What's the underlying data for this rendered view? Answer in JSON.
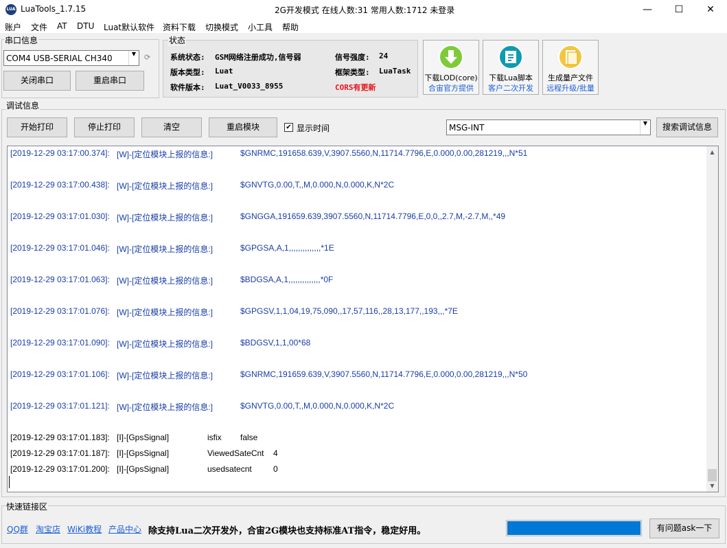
{
  "window": {
    "app_title": "LuaTools_1.7.15",
    "status_title": "2G开发模式 在线人数:31 常用人数:1712 未登录",
    "minimize": "—",
    "maximize": "☐",
    "close": "✕",
    "icon_text": "LUA"
  },
  "menu": [
    "账户",
    "文件",
    "AT",
    "DTU",
    "Luat默认软件",
    "资料下载",
    "切换模式",
    "小工具",
    "帮助"
  ],
  "serial": {
    "group_label": "串口信息",
    "port_value": "COM4 USB-SERIAL CH340",
    "close_btn": "关闭串口",
    "restart_btn": "重启串口"
  },
  "status": {
    "group_label": "状态",
    "rows": [
      {
        "label": "系统状态:",
        "value": "GSM网络注册成功,信号弱"
      },
      {
        "label": "版本类型:",
        "value": "Luat"
      },
      {
        "label": "软件版本:",
        "value": "Luat_V0033_8955"
      }
    ],
    "signal_label": "信号强度:",
    "signal_value": "24",
    "framework_label": "框架类型:",
    "framework_value": "LuaTask",
    "cors_update": "CORS有更新"
  },
  "tools": [
    {
      "line1": "下载LOD(core)",
      "line2": "合宙官方提供"
    },
    {
      "line1": "下载Lua脚本",
      "line2": "客户二次开发"
    },
    {
      "line1": "生成量产文件",
      "line2": "远程升级/批量"
    }
  ],
  "debug": {
    "group_label": "调试信息",
    "start_print": "开始打印",
    "stop_print": "停止打印",
    "clear": "清空",
    "restart_module": "重启模块",
    "show_time_label": "显示时间",
    "show_time_check": "✔",
    "filter_value": "MSG-INT",
    "search_btn": "搜索调试信息"
  },
  "log": [
    {
      "time": "[2019-12-29 03:17:00.374]:",
      "tag": "[W]-[定位模块上报的信息:]",
      "msg": "$GNRMC,191658.639,V,3907.5560,N,11714.7796,E,0.000,0.00,281219,,,N*51"
    },
    {
      "time": "[2019-12-29 03:17:00.438]:",
      "tag": "[W]-[定位模块上报的信息:]",
      "msg": "$GNVTG,0.00,T,,M,0.000,N,0.000,K,N*2C"
    },
    {
      "time": "[2019-12-29 03:17:01.030]:",
      "tag": "[W]-[定位模块上报的信息:]",
      "msg": "$GNGGA,191659.639,3907.5560,N,11714.7796,E,0,0,,2.7,M,-2.7,M,,*49"
    },
    {
      "time": "[2019-12-29 03:17:01.046]:",
      "tag": "[W]-[定位模块上报的信息:]",
      "msg": "$GPGSA,A,1,,,,,,,,,,,,,,*1E"
    },
    {
      "time": "[2019-12-29 03:17:01.063]:",
      "tag": "[W]-[定位模块上报的信息:]",
      "msg": "$BDGSA,A,1,,,,,,,,,,,,,,*0F"
    },
    {
      "time": "[2019-12-29 03:17:01.076]:",
      "tag": "[W]-[定位模块上报的信息:]",
      "msg": "$GPGSV,1,1,04,19,75,090,,17,57,116,,28,13,177,,193,,,*7E"
    },
    {
      "time": "[2019-12-29 03:17:01.090]:",
      "tag": "[W]-[定位模块上报的信息:]",
      "msg": "$BDGSV,1,1,00*68"
    },
    {
      "time": "[2019-12-29 03:17:01.106]:",
      "tag": "[W]-[定位模块上报的信息:]",
      "msg": "$GNRMC,191659.639,V,3907.5560,N,11714.7796,E,0.000,0.00,281219,,,N*50"
    },
    {
      "time": "[2019-12-29 03:17:01.121]:",
      "tag": "[W]-[定位模块上报的信息:]",
      "msg": "$GNVTG,0.00,T,,M,0.000,N,0.000,K,N*2C"
    },
    {
      "time": "[2019-12-29 03:17:01.183]:",
      "tag": "[I]-[GpsSignal]",
      "key": "isfix",
      "val": "false"
    },
    {
      "time": "[2019-12-29 03:17:01.187]:",
      "tag": "[I]-[GpsSignal]",
      "key": "ViewedSateCnt",
      "val": "4"
    },
    {
      "time": "[2019-12-29 03:17:01.200]:",
      "tag": "[I]-[GpsSignal]",
      "key": "usedsatecnt",
      "val": "0"
    }
  ],
  "quick": {
    "group_label": "快速链接区",
    "links": [
      "QQ群",
      "淘宝店",
      "WiKi教程",
      "产品中心"
    ],
    "promo": "除支持Lua二次开发外，合宙2G模块也支持标准AT指令，稳定好用。",
    "progress_fraction": 1.0,
    "ask_btn": "有问题ask一下"
  },
  "colors": {
    "log_blue": "#1a3da8",
    "link_blue": "#1b5fd6",
    "cors_red": "#e8151b",
    "progress_blue": "#0078d7",
    "icon_green": "#7ecb3a",
    "icon_teal": "#0d9bb0",
    "icon_yellow": "#f5c542"
  }
}
